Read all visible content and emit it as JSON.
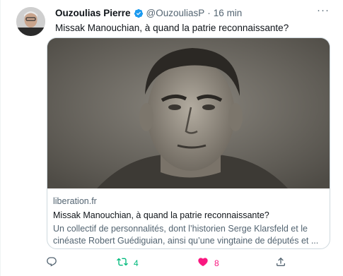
{
  "tweet": {
    "author_name": "Ouzoulias Pierre",
    "handle": "@OuzouliasP",
    "separator": "·",
    "time": "16 min",
    "text": "Missak Manouchian, à quand la patrie reconnaissante?",
    "more_glyph": "···"
  },
  "card": {
    "domain": "liberation.fr",
    "title": "Missak Manouchian, à quand la patrie reconnaissante?",
    "description_line1": "Un collectif de personnalités, dont l’historien Serge Klarsfeld et le",
    "description_line2": "cinéaste Robert Guédiguian, ainsi qu’une vingtaine de députés et ..."
  },
  "actions": {
    "reply_count": "",
    "retweet_count": "4",
    "like_count": "8"
  },
  "colors": {
    "verified": "#1d9bf0",
    "retweet": "#00ba7c",
    "like": "#f91880",
    "secondary_text": "#536471"
  },
  "icons": [
    "verified-badge-icon",
    "more-icon",
    "reply-icon",
    "retweet-icon",
    "like-icon",
    "share-icon"
  ]
}
